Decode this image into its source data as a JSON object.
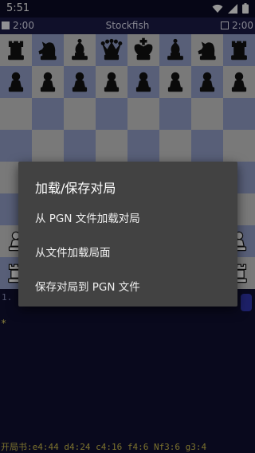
{
  "status_bar": {
    "time": "5:51",
    "icons": [
      "wifi-icon",
      "signal-icon",
      "battery-icon"
    ]
  },
  "clock_bar": {
    "white_time": "2:00",
    "engine_name": "Stockfish",
    "black_time": "2:00"
  },
  "board": {
    "light_color": "#c3c3c3",
    "dark_color": "#8e9ac2",
    "ranks": [
      [
        "bR",
        "bN",
        "bB",
        "bQ",
        "bK",
        "bB",
        "bN",
        "bR"
      ],
      [
        "bP",
        "bP",
        "bP",
        "bP",
        "bP",
        "bP",
        "bP",
        "bP"
      ],
      [
        "",
        "",
        "",
        "",
        "",
        "",
        "",
        ""
      ],
      [
        "",
        "",
        "",
        "",
        "",
        "",
        "",
        ""
      ],
      [
        "",
        "",
        "",
        "",
        "",
        "",
        "",
        ""
      ],
      [
        "",
        "",
        "",
        "",
        "",
        "",
        "",
        ""
      ],
      [
        "wP",
        "wP",
        "wP",
        "wP",
        "wP",
        "wP",
        "wP",
        "wP"
      ],
      [
        "wR",
        "wN",
        "wB",
        "wQ",
        "wK",
        "wB",
        "wN",
        "wR"
      ]
    ]
  },
  "moves": {
    "first_line": "1.",
    "marker": "*"
  },
  "book_line": "开局书:e4:44 d4:24 c4:16 f4:6 Nf3:6 g3:4",
  "dialog": {
    "title": "加载/保存对局",
    "items": [
      "从 PGN 文件加载对局",
      "从文件加载局面",
      "保存对局到 PGN 文件"
    ]
  }
}
